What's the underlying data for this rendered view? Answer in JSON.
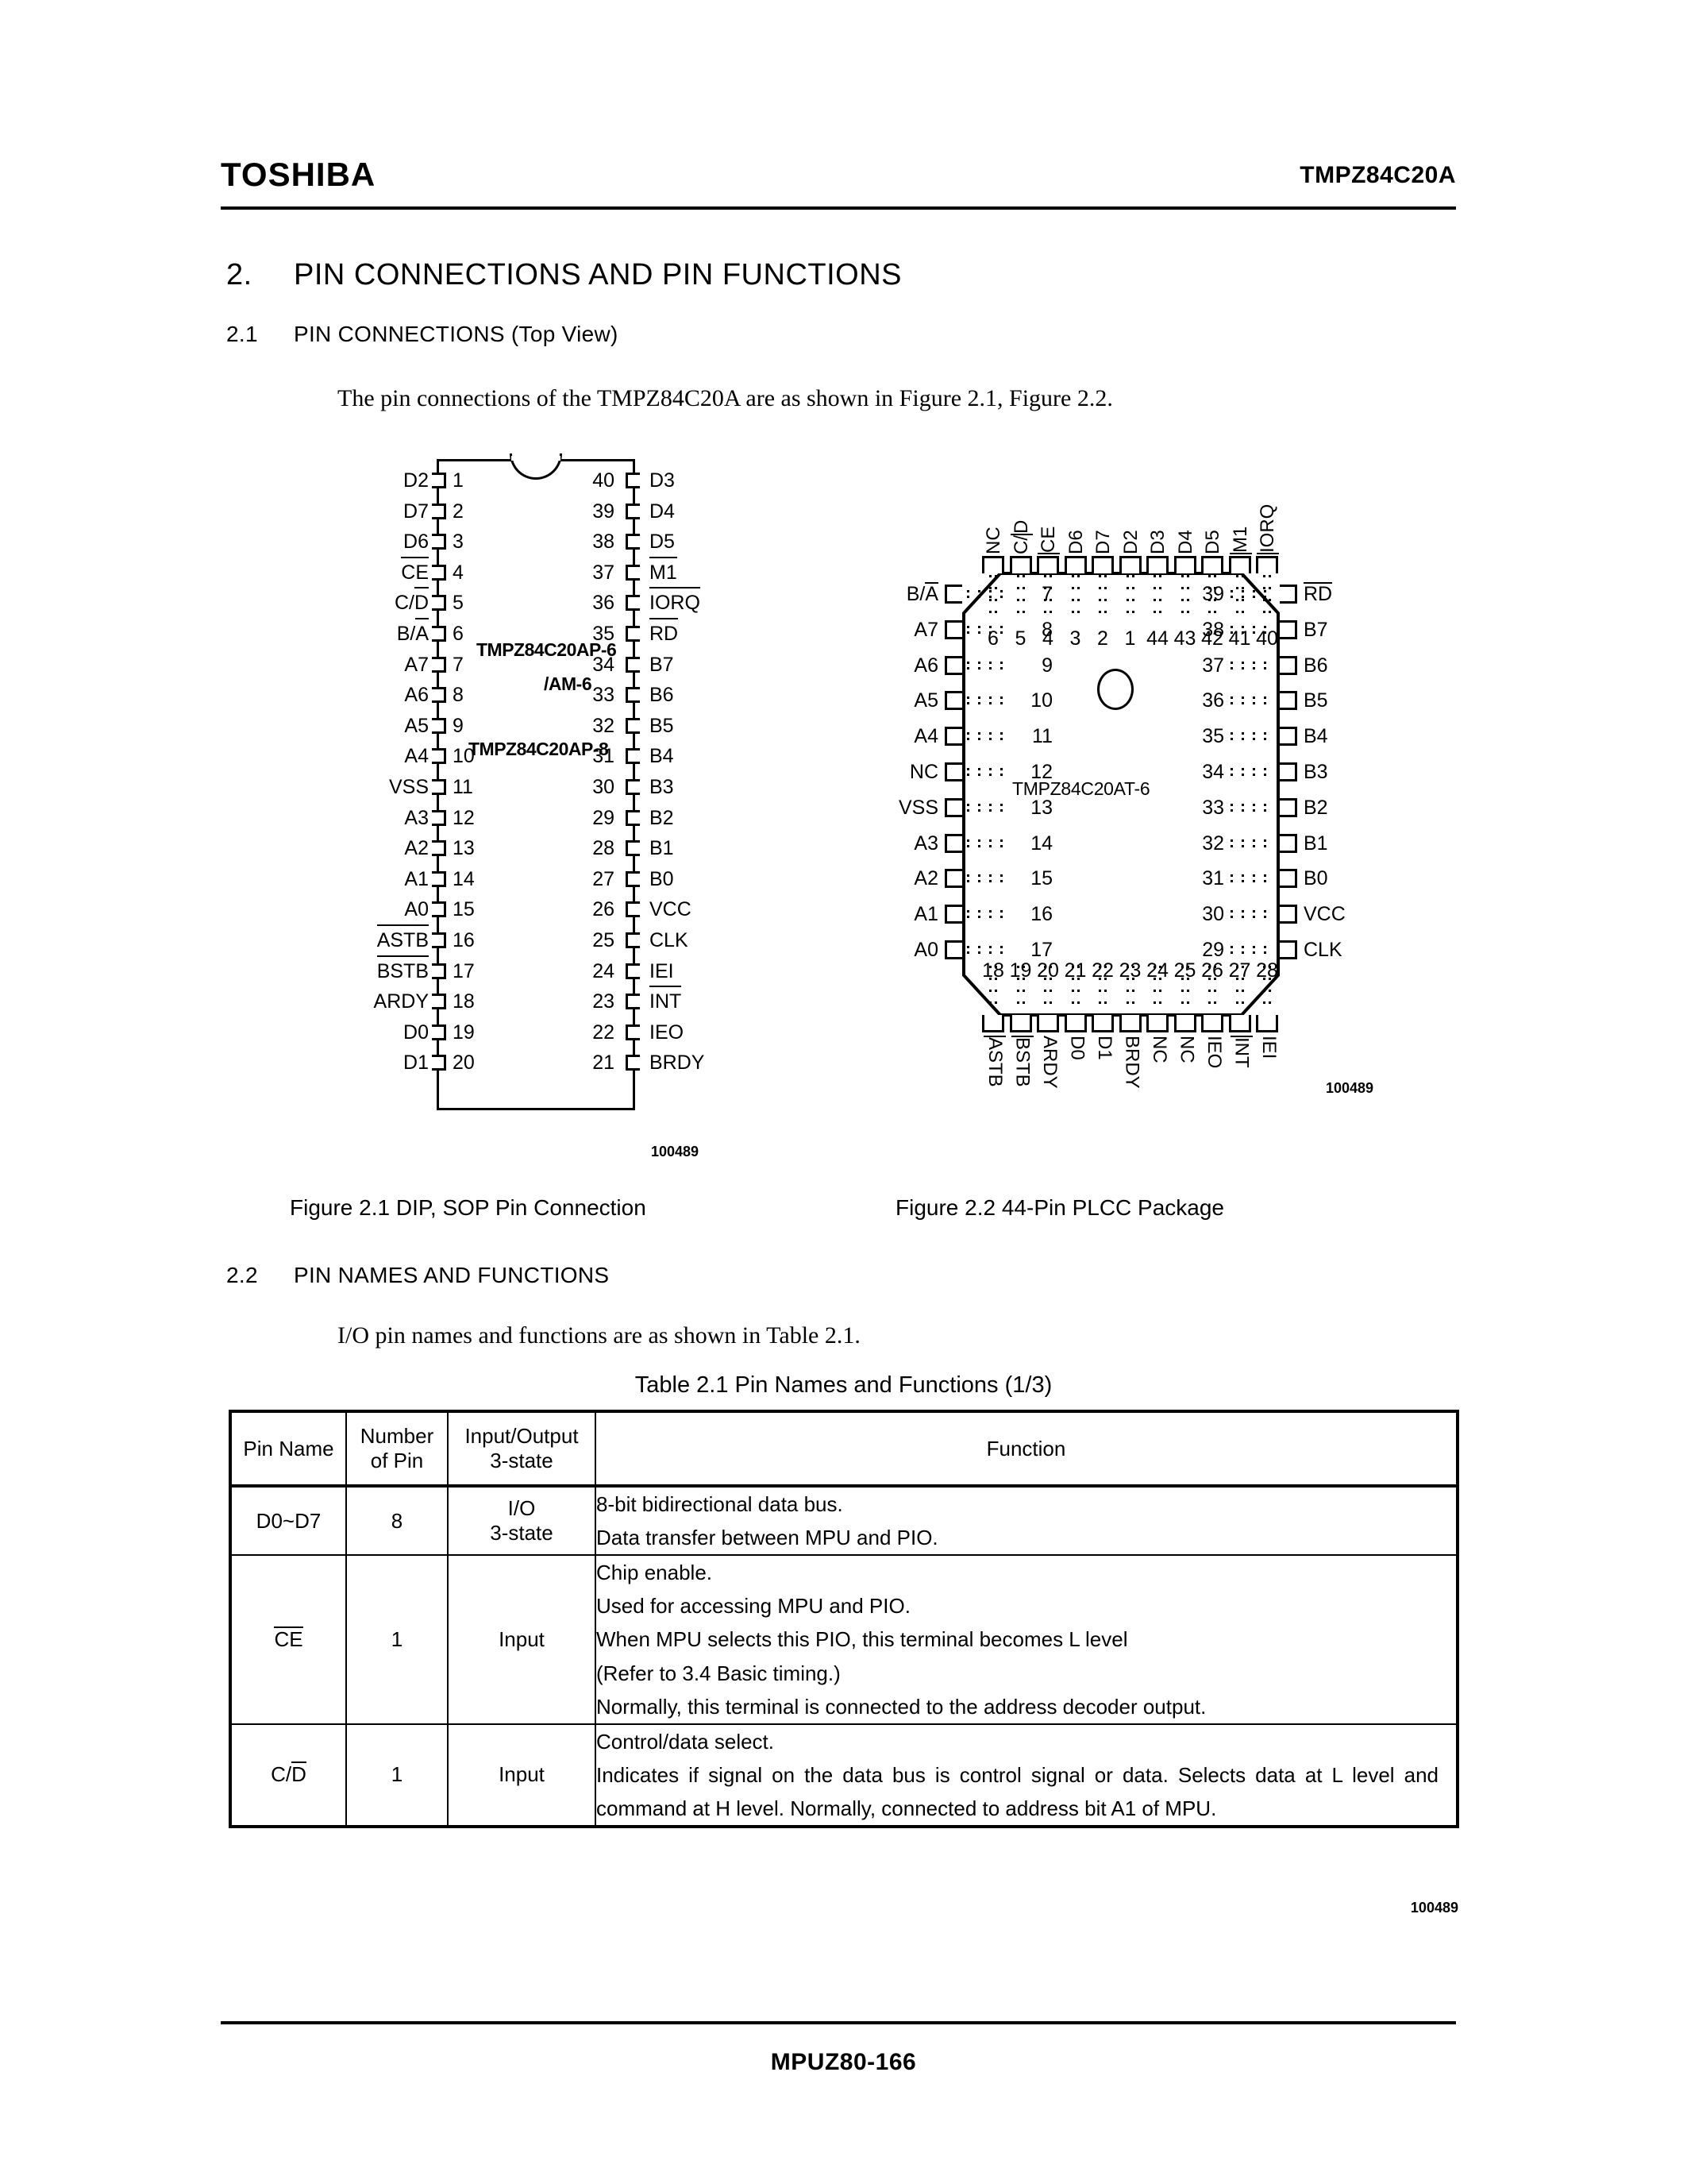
{
  "header": {
    "brand": "TOSHIBA",
    "part_number": "TMPZ84C20A"
  },
  "sections": {
    "s2_num": "2.",
    "s2_title": "PIN CONNECTIONS AND PIN FUNCTIONS",
    "s21_num": "2.1",
    "s21_title": "PIN CONNECTIONS (Top View)",
    "s21_para": "The pin connections of the TMPZ84C20A are as shown in Figure 2.1, Figure 2.2.",
    "s22_num": "2.2",
    "s22_title": "PIN NAMES AND FUNCTIONS",
    "s22_para": "I/O pin names and functions are as shown in Table 2.1."
  },
  "dip": {
    "part_line1": "TMPZ84C20AP-6",
    "part_line2": "/AM-6",
    "part_line3": "TMPZ84C20AP-8",
    "drawing_code": "100489",
    "left": [
      {
        "num": "1",
        "name": "D2",
        "bar": "none"
      },
      {
        "num": "2",
        "name": "D7",
        "bar": "none"
      },
      {
        "num": "3",
        "name": "D6",
        "bar": "none"
      },
      {
        "num": "4",
        "name": "CE",
        "bar": "full"
      },
      {
        "num": "5",
        "name": "C/D",
        "bar": "second"
      },
      {
        "num": "6",
        "name": "B/A",
        "bar": "second"
      },
      {
        "num": "7",
        "name": "A7",
        "bar": "none"
      },
      {
        "num": "8",
        "name": "A6",
        "bar": "none"
      },
      {
        "num": "9",
        "name": "A5",
        "bar": "none"
      },
      {
        "num": "10",
        "name": "A4",
        "bar": "none"
      },
      {
        "num": "11",
        "name": "VSS",
        "bar": "none"
      },
      {
        "num": "12",
        "name": "A3",
        "bar": "none"
      },
      {
        "num": "13",
        "name": "A2",
        "bar": "none"
      },
      {
        "num": "14",
        "name": "A1",
        "bar": "none"
      },
      {
        "num": "15",
        "name": "A0",
        "bar": "none"
      },
      {
        "num": "16",
        "name": "ASTB",
        "bar": "full"
      },
      {
        "num": "17",
        "name": "BSTB",
        "bar": "full"
      },
      {
        "num": "18",
        "name": "ARDY",
        "bar": "none"
      },
      {
        "num": "19",
        "name": "D0",
        "bar": "none"
      },
      {
        "num": "20",
        "name": "D1",
        "bar": "none"
      }
    ],
    "right": [
      {
        "num": "40",
        "name": "D3",
        "bar": "none"
      },
      {
        "num": "39",
        "name": "D4",
        "bar": "none"
      },
      {
        "num": "38",
        "name": "D5",
        "bar": "none"
      },
      {
        "num": "37",
        "name": "M1",
        "bar": "full"
      },
      {
        "num": "36",
        "name": "IORQ",
        "bar": "full"
      },
      {
        "num": "35",
        "name": "RD",
        "bar": "full"
      },
      {
        "num": "34",
        "name": "B7",
        "bar": "none"
      },
      {
        "num": "33",
        "name": "B6",
        "bar": "none"
      },
      {
        "num": "32",
        "name": "B5",
        "bar": "none"
      },
      {
        "num": "31",
        "name": "B4",
        "bar": "none"
      },
      {
        "num": "30",
        "name": "B3",
        "bar": "none"
      },
      {
        "num": "29",
        "name": "B2",
        "bar": "none"
      },
      {
        "num": "28",
        "name": "B1",
        "bar": "none"
      },
      {
        "num": "27",
        "name": "B0",
        "bar": "none"
      },
      {
        "num": "26",
        "name": "VCC",
        "bar": "none"
      },
      {
        "num": "25",
        "name": "CLK",
        "bar": "none"
      },
      {
        "num": "24",
        "name": "IEI",
        "bar": "none"
      },
      {
        "num": "23",
        "name": "INT",
        "bar": "full"
      },
      {
        "num": "22",
        "name": "IEO",
        "bar": "none"
      },
      {
        "num": "21",
        "name": "BRDY",
        "bar": "none"
      }
    ]
  },
  "plcc": {
    "part": "TMPZ84C20AT-6",
    "drawing_code": "100489",
    "top": [
      {
        "num": "6",
        "name": "NC",
        "bar": "none"
      },
      {
        "num": "5",
        "name": "C/D",
        "bar": "second"
      },
      {
        "num": "4",
        "name": "CE",
        "bar": "full"
      },
      {
        "num": "3",
        "name": "D6",
        "bar": "none"
      },
      {
        "num": "2",
        "name": "D7",
        "bar": "none"
      },
      {
        "num": "1",
        "name": "D2",
        "bar": "none"
      },
      {
        "num": "44",
        "name": "D3",
        "bar": "none"
      },
      {
        "num": "43",
        "name": "D4",
        "bar": "none"
      },
      {
        "num": "42",
        "name": "D5",
        "bar": "none"
      },
      {
        "num": "41",
        "name": "M1",
        "bar": "full"
      },
      {
        "num": "40",
        "name": "IORQ",
        "bar": "full"
      }
    ],
    "left": [
      {
        "num": "7",
        "name": "B/A",
        "bar": "second"
      },
      {
        "num": "8",
        "name": "A7",
        "bar": "none"
      },
      {
        "num": "9",
        "name": "A6",
        "bar": "none"
      },
      {
        "num": "10",
        "name": "A5",
        "bar": "none"
      },
      {
        "num": "11",
        "name": "A4",
        "bar": "none"
      },
      {
        "num": "12",
        "name": "NC",
        "bar": "none"
      },
      {
        "num": "13",
        "name": "VSS",
        "bar": "none"
      },
      {
        "num": "14",
        "name": "A3",
        "bar": "none"
      },
      {
        "num": "15",
        "name": "A2",
        "bar": "none"
      },
      {
        "num": "16",
        "name": "A1",
        "bar": "none"
      },
      {
        "num": "17",
        "name": "A0",
        "bar": "none"
      }
    ],
    "right": [
      {
        "num": "39",
        "name": "RD",
        "bar": "full"
      },
      {
        "num": "38",
        "name": "B7",
        "bar": "none"
      },
      {
        "num": "37",
        "name": "B6",
        "bar": "none"
      },
      {
        "num": "36",
        "name": "B5",
        "bar": "none"
      },
      {
        "num": "35",
        "name": "B4",
        "bar": "none"
      },
      {
        "num": "34",
        "name": "B3",
        "bar": "none"
      },
      {
        "num": "33",
        "name": "B2",
        "bar": "none"
      },
      {
        "num": "32",
        "name": "B1",
        "bar": "none"
      },
      {
        "num": "31",
        "name": "B0",
        "bar": "none"
      },
      {
        "num": "30",
        "name": "VCC",
        "bar": "none"
      },
      {
        "num": "29",
        "name": "CLK",
        "bar": "none"
      }
    ],
    "bottom": [
      {
        "num": "18",
        "name": "ASTB",
        "bar": "full"
      },
      {
        "num": "19",
        "name": "BSTB",
        "bar": "full"
      },
      {
        "num": "20",
        "name": "ARDY",
        "bar": "none"
      },
      {
        "num": "21",
        "name": "D0",
        "bar": "none"
      },
      {
        "num": "22",
        "name": "D1",
        "bar": "none"
      },
      {
        "num": "23",
        "name": "BRDY",
        "bar": "none"
      },
      {
        "num": "24",
        "name": "NC",
        "bar": "none"
      },
      {
        "num": "25",
        "name": "NC",
        "bar": "none"
      },
      {
        "num": "26",
        "name": "IEO",
        "bar": "none"
      },
      {
        "num": "27",
        "name": "INT",
        "bar": "full"
      },
      {
        "num": "28",
        "name": "IEI",
        "bar": "none"
      }
    ]
  },
  "captions": {
    "fig1": "Figure 2.1   DIP, SOP Pin Connection",
    "fig2": "Figure 2.2   44-Pin PLCC Package"
  },
  "table": {
    "title": "Table 2.1   Pin Names and Functions (1/3)",
    "drawing_code": "100489",
    "headers": {
      "c1_l1": "Pin Name",
      "c2_l1": "Number",
      "c2_l2": "of Pin",
      "c3_l1": "Input/Output",
      "c3_l2": "3-state",
      "c4": "Function"
    },
    "rows": [
      {
        "pin_name": "D0~D7",
        "pin_bar": "none",
        "count": "8",
        "io_l1": "I/O",
        "io_l2": "3-state",
        "function_lines": [
          "8-bit bidirectional data bus.",
          "Data transfer between MPU and PIO."
        ]
      },
      {
        "pin_name": "CE",
        "pin_bar": "full",
        "count": "1",
        "io_l1": "Input",
        "io_l2": "",
        "function_lines": [
          "Chip enable.",
          "Used for accessing MPU and PIO.",
          "When MPU selects this PIO, this terminal becomes L level",
          "(Refer to 3.4 Basic timing.)",
          "Normally, this terminal is connected to the address decoder output."
        ]
      },
      {
        "pin_name": "C/D",
        "pin_bar": "second",
        "count": "1",
        "io_l1": "Input",
        "io_l2": "",
        "function_lines": [
          "Control/data select.",
          "Indicates if signal on the data bus is control signal or data.  Selects data at L level and command at H level.  Normally, connected to address bit A1 of MPU."
        ],
        "justify_from": 1
      }
    ]
  },
  "footer": {
    "page_id": "MPUZ80-166"
  }
}
